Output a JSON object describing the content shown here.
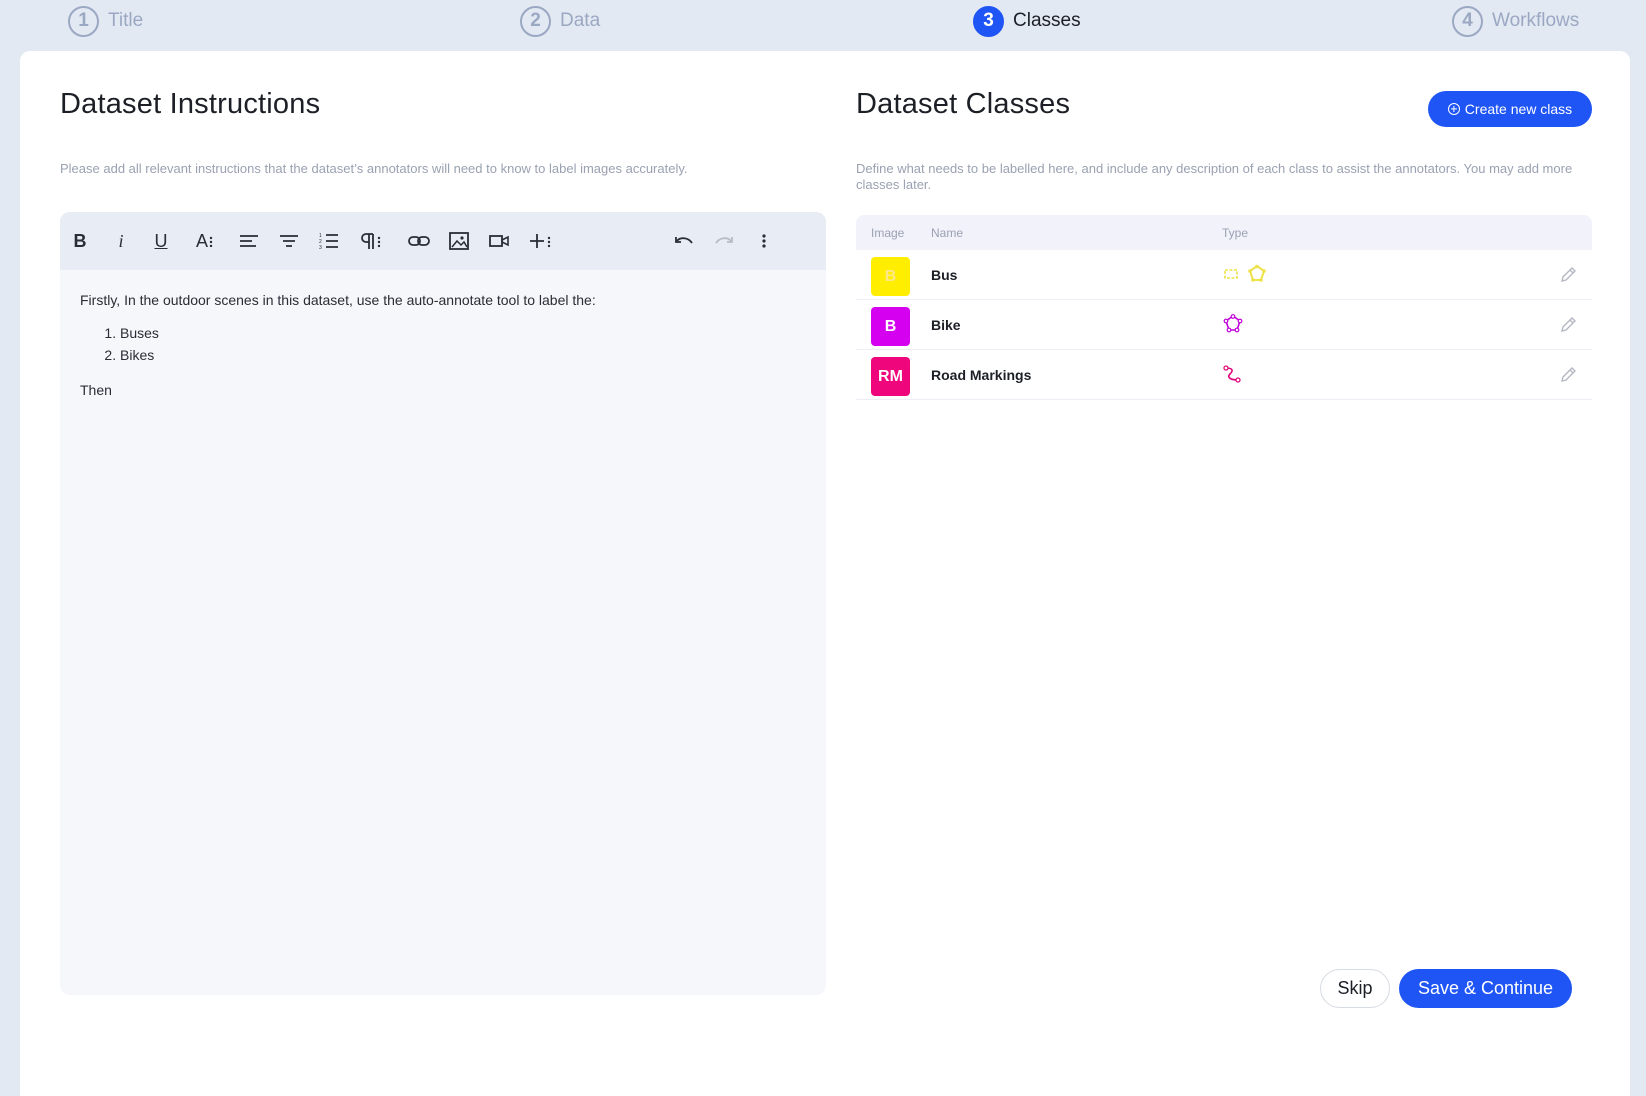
{
  "stepper": {
    "steps": [
      {
        "number": "1",
        "label": "Title"
      },
      {
        "number": "2",
        "label": "Data"
      },
      {
        "number": "3",
        "label": "Classes"
      },
      {
        "number": "4",
        "label": "Workflows"
      }
    ],
    "active_step": "3"
  },
  "instructions": {
    "title": "Dataset Instructions",
    "description": "Please add all relevant instructions that the dataset’s annotators will need to know to label images accurately.",
    "toolbar_icons": [
      "bold-icon",
      "italic-icon",
      "underline-icon",
      "font-size-icon",
      "align-left-icon",
      "align-center-icon",
      "ordered-list-icon",
      "paragraph-icon",
      "link-icon",
      "image-icon",
      "video-icon",
      "insert-icon",
      "undo-icon",
      "redo-icon",
      "more-options-icon"
    ],
    "bold_label": "B",
    "italic_label": "i",
    "underline_label": "U",
    "font_size_label": "A",
    "content": {
      "intro": "Firstly, In the outdoor scenes in this dataset, use the auto-annotate tool to label the:",
      "list": [
        "Buses",
        "Bikes"
      ],
      "closing": "Then"
    }
  },
  "classes": {
    "title": "Dataset Classes",
    "create_button": "Create new class",
    "description": "Define what needs to be labelled here, and include any description of each class to assist the annotators. You may add more classes later.",
    "columns": {
      "image": "Image",
      "name": "Name",
      "type": "Type"
    },
    "rows": [
      {
        "initials": "B",
        "name": "Bus",
        "color": "#ffee00",
        "types": [
          "bounding-box-icon",
          "polygon-icon"
        ]
      },
      {
        "initials": "B",
        "name": "Bike",
        "color": "#d600f0",
        "types": [
          "polygon-icon"
        ]
      },
      {
        "initials": "RM",
        "name": "Road Markings",
        "color": "#f0067c",
        "types": [
          "polyline-icon"
        ]
      }
    ]
  },
  "footer": {
    "skip": "Skip",
    "save": "Save & Continue"
  },
  "colors": {
    "accent": "#1f55f5",
    "background": "#e3e9f3"
  }
}
